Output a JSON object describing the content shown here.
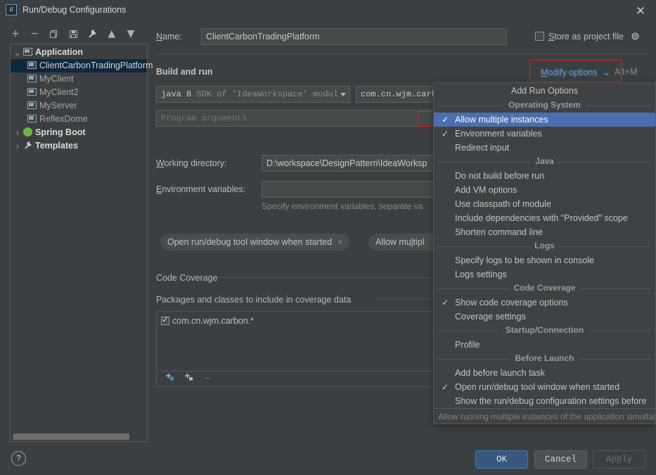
{
  "window": {
    "title": "Run/Debug Configurations",
    "icon": "IJ",
    "close_icon": "close-icon"
  },
  "toolbar": {
    "buttons": [
      {
        "name": "add-configuration-button",
        "glyph": "+"
      },
      {
        "name": "remove-configuration-button",
        "glyph": "−"
      },
      {
        "name": "copy-configuration-button",
        "glyph": "copy-icon"
      },
      {
        "name": "save-configuration-button",
        "glyph": "save-icon"
      },
      {
        "name": "edit-templates-button",
        "glyph": "wrench-icon"
      },
      {
        "name": "move-up-button",
        "glyph": "▲"
      },
      {
        "name": "move-down-button",
        "glyph": "▼"
      },
      {
        "name": "more-options-button",
        "glyph": "»"
      }
    ]
  },
  "tree": {
    "items": [
      {
        "label": "Application",
        "level": 0,
        "expanded": true,
        "arrow": "⌄",
        "icon": "application-icon",
        "bold": true,
        "selected": false
      },
      {
        "label": "ClientCarbonTradingPlatform",
        "level": 1,
        "expanded": false,
        "arrow": "",
        "icon": "application-icon",
        "bold": false,
        "selected": true
      },
      {
        "label": "MyClient",
        "level": 1,
        "expanded": false,
        "arrow": "",
        "icon": "application-icon",
        "bold": false,
        "selected": false
      },
      {
        "label": "MyClient2",
        "level": 1,
        "expanded": false,
        "arrow": "",
        "icon": "application-icon",
        "bold": false,
        "selected": false
      },
      {
        "label": "MyServer",
        "level": 1,
        "expanded": false,
        "arrow": "",
        "icon": "application-icon",
        "bold": false,
        "selected": false
      },
      {
        "label": "ReflexDome",
        "level": 1,
        "expanded": false,
        "arrow": "",
        "icon": "application-icon",
        "bold": false,
        "selected": false
      },
      {
        "label": "Spring Boot",
        "level": 0,
        "expanded": false,
        "arrow": "›",
        "icon": "spring-boot-icon",
        "bold": true,
        "selected": false
      },
      {
        "label": "Templates",
        "level": 0,
        "expanded": false,
        "arrow": "›",
        "icon": "wrench-icon",
        "bold": true,
        "selected": false
      }
    ]
  },
  "form": {
    "name_label": "Name:",
    "name_label_mnemonic": "N",
    "name_value": "ClientCarbonTradingPlatform",
    "store_as_project_file_label": "tore as project file",
    "store_as_project_file_mnemonic": "S",
    "store_as_project_file_checked": false,
    "gear_icon": "gear-icon",
    "modify_options_label": "odify options",
    "modify_options_mnemonic": "M",
    "modify_options_shortcut": "Alt+M",
    "build_and_run_title": "Build and run",
    "sdk_value_bold": "java 8",
    "sdk_value_dim": "SDK of 'IdeaWorkspace' modul",
    "main_class_value": "com.cn.wjm.carbo",
    "program_arguments_placeholder": "Program arguments",
    "working_directory_label": "orking directory:",
    "working_directory_mnemonic": "W",
    "working_directory_value": "D:\\workspace\\DesignPattern\\IdeaWorksp",
    "environment_variables_label": "nvironment variables:",
    "environment_variables_mnemonic": "E",
    "environment_variables_value": "",
    "environment_variables_hint": "Specify environment variables, separate va",
    "pills": [
      {
        "label": "Open run/debug tool window when started",
        "close": "×",
        "name": "pill-open-run-debug-tool-window"
      },
      {
        "label": "Allow multipl",
        "close": "",
        "name": "pill-allow-multiple-instances"
      }
    ]
  },
  "coverage": {
    "section_title": "Code Coverage",
    "packages_title": "Packages and classes to include in coverage data",
    "items": [
      {
        "label": "com.cn.wjm.carbon.*",
        "checked": true
      }
    ],
    "toolbar": [
      {
        "name": "add-class-button",
        "glyph": "+"
      },
      {
        "name": "add-package-button",
        "glyph": "+"
      },
      {
        "name": "remove-pattern-button",
        "glyph": "−"
      }
    ]
  },
  "menu": {
    "title": "Add Run Options",
    "sections": [
      {
        "header": "Operating System",
        "items": [
          {
            "label": "Allow multiple instances",
            "checked": true,
            "highlighted": true
          },
          {
            "label": "Environment variables",
            "checked": true,
            "highlighted": false
          },
          {
            "label": "Redirect input",
            "checked": false,
            "highlighted": false
          }
        ]
      },
      {
        "header": "Java",
        "items": [
          {
            "label": "Do not build before run",
            "checked": false,
            "highlighted": false
          },
          {
            "label": "Add VM options",
            "checked": false,
            "highlighted": false
          },
          {
            "label": "Use classpath of module",
            "checked": false,
            "highlighted": false
          },
          {
            "label": "Include dependencies with \"Provided\" scope",
            "checked": false,
            "highlighted": false
          },
          {
            "label": "Shorten command line",
            "checked": false,
            "highlighted": false
          }
        ]
      },
      {
        "header": "Logs",
        "items": [
          {
            "label": "Specify logs to be shown in console",
            "checked": false,
            "highlighted": false
          },
          {
            "label": "Logs settings",
            "checked": false,
            "highlighted": false
          }
        ]
      },
      {
        "header": "Code Coverage",
        "items": [
          {
            "label": "Show code coverage options",
            "checked": true,
            "highlighted": false
          },
          {
            "label": "Coverage settings",
            "checked": false,
            "highlighted": false
          }
        ]
      },
      {
        "header": "Startup/Connection",
        "items": [
          {
            "label": "Profile",
            "checked": false,
            "highlighted": false
          }
        ]
      },
      {
        "header": "Before Launch",
        "items": [
          {
            "label": "Add before launch task",
            "checked": false,
            "highlighted": false
          },
          {
            "label": "Open run/debug tool window when started",
            "checked": true,
            "highlighted": false
          },
          {
            "label": "Show the run/debug configuration settings before",
            "checked": false,
            "highlighted": false
          }
        ]
      }
    ],
    "tooltip": "Allow running multiple instances of the application simultaneou",
    "checkmark": "✓"
  },
  "footer": {
    "help_label": "?",
    "ok_label": "OK",
    "cancel_label": "Cancel",
    "apply_label": "Apply"
  },
  "colors": {
    "background": "#3c3f41",
    "selection_blue": "#4b6eaf",
    "tree_selection": "#0d293e",
    "link_blue": "#6aa3e0",
    "highlight_red": "#e02020",
    "primary_button": "#365880"
  }
}
